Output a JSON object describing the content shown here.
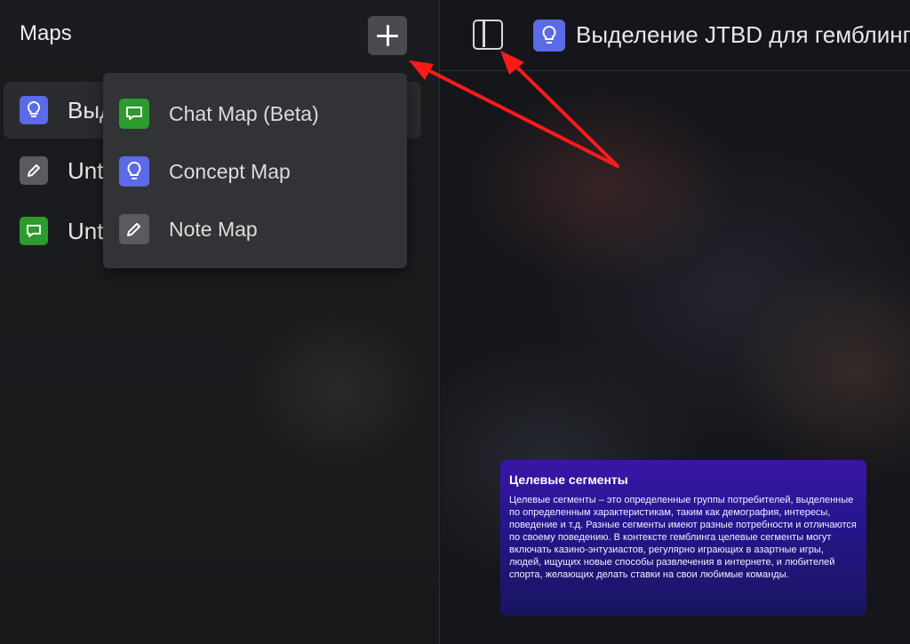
{
  "sidebar": {
    "title": "Maps",
    "items": [
      {
        "label": "Выд",
        "icon": "lightbulb-icon",
        "selected": true
      },
      {
        "label": "Unt",
        "icon": "pencil-icon",
        "selected": false
      },
      {
        "label": "Unt",
        "icon": "chat-icon",
        "selected": false
      }
    ]
  },
  "menu": {
    "items": [
      {
        "label": "Chat Map (Beta)",
        "icon": "chat-icon"
      },
      {
        "label": "Concept Map",
        "icon": "lightbulb-icon"
      },
      {
        "label": "Note Map",
        "icon": "pencil-icon"
      }
    ]
  },
  "main": {
    "title": "Выделение JTBD для гемблинг",
    "card": {
      "title": "Целевые сегменты",
      "body": "Целевые сегменты – это определенные группы потребителей, выделенные по определенным характеристикам, таким как демография, интересы, поведение и т.д. Разные сегменты имеют разные потребности и отличаются по своему поведению. В контексте гемблинга целевые сегменты могут включать казино-энтузиастов, регулярно играющих в азартные игры, людей, ищущих новые способы развлечения в интернете, и любителей спорта, желающих делать ставки на свои любимые команды."
    }
  },
  "colors": {
    "concept": "#5b6ae6",
    "chat": "#2d9b2d",
    "note": "#5a5b5f",
    "arrow": "#ff1a1a"
  }
}
